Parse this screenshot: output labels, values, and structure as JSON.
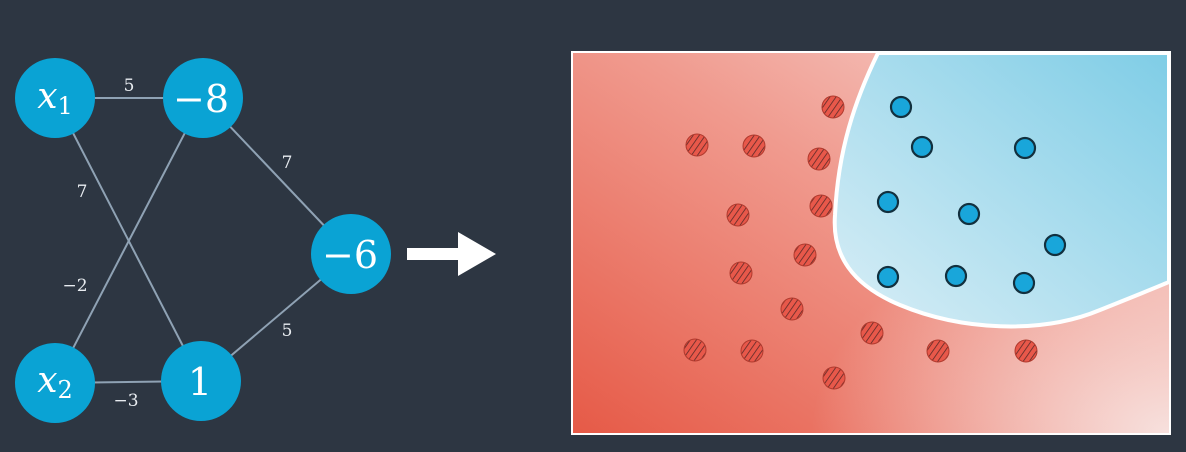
{
  "network": {
    "nodes": {
      "x1": {
        "base": "x",
        "sub": "1"
      },
      "x2": {
        "base": "x",
        "sub": "2"
      },
      "h1": {
        "text": "−8"
      },
      "h2": {
        "text": "1"
      },
      "out": {
        "text": "−6"
      }
    },
    "edges": {
      "x1_h1": "5",
      "x1_h2": "7",
      "x2_h1": "−2",
      "x2_h2": "−3",
      "h1_out": "7",
      "h2_out": "5"
    }
  },
  "colors": {
    "background": "#2d3642",
    "node": "#0aa3d4",
    "edge": "#8fa2b4",
    "arrow": "#ffffff",
    "red_region": "#e8584a",
    "blue_region": "#7fcde6",
    "red_point": "#e8584a",
    "blue_point": "#19a6da"
  }
}
